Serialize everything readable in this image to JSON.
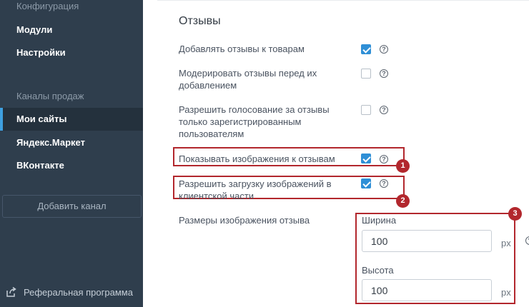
{
  "sidebar": {
    "section_config": "Конфигурация",
    "items_config": [
      {
        "label": "Модули"
      },
      {
        "label": "Настройки"
      }
    ],
    "section_channels": "Каналы продаж",
    "items_channels": [
      {
        "label": "Мои сайты",
        "active": true
      },
      {
        "label": "Яндекс.Маркет"
      },
      {
        "label": "ВКонтакте"
      }
    ],
    "add_channel": "Добавить канал",
    "referral": "Реферальная программа"
  },
  "main": {
    "title": "Отзывы",
    "settings": [
      {
        "label": "Добавлять отзывы к товарам",
        "checked": true
      },
      {
        "label": "Модерировать отзывы перед их добавлением",
        "checked": false
      },
      {
        "label": "Разрешить голосование за отзывы только зарегистрированным пользователям",
        "checked": false
      },
      {
        "label": "Показывать изображения к отзывам",
        "checked": true
      },
      {
        "label": "Разрешить загрузку изображений в клиентской части",
        "checked": true
      }
    ],
    "image_size": {
      "label": "Размеры изображения отзыва",
      "width_label": "Ширина",
      "width_value": "100",
      "height_label": "Высота",
      "height_value": "100",
      "unit": "px"
    },
    "help_glyph": "?"
  },
  "annotations": {
    "badges": [
      "1",
      "2",
      "3"
    ],
    "color": "#b2272d"
  },
  "colors": {
    "sidebar_bg": "#2f3e4d",
    "active_accent": "#3ea0e0",
    "checkbox_on": "#2f8fd6"
  }
}
